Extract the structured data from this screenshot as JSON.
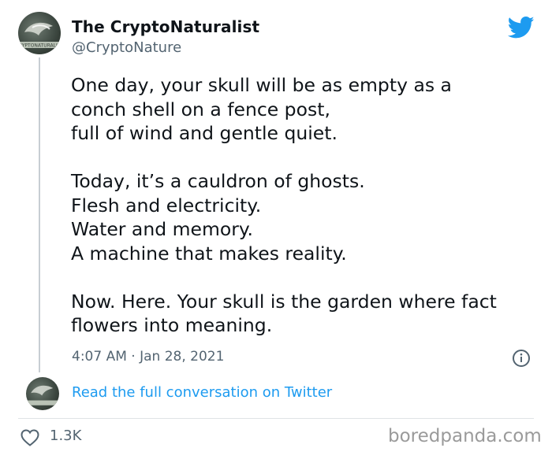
{
  "author": {
    "name": "The CryptoNaturalist",
    "handle": "@CryptoNature",
    "avatar_text": "CRYPTONATURALIST"
  },
  "tweet": {
    "paragraphs": [
      "One day, your skull will be as empty as a\nconch shell on a fence post,\nfull of wind and gentle quiet.",
      "Today, it’s a cauldron of ghosts.\nFlesh and electricity.\nWater and memory.\nA machine that makes reality.",
      "Now. Here. Your skull is the garden where fact\nflowers into meaning."
    ],
    "timestamp": "4:07 AM · Jan 28, 2021"
  },
  "footer": {
    "read_more": "Read the full conversation on Twitter",
    "like_count": "1.3K",
    "watermark": "boredpanda.com"
  },
  "colors": {
    "accent": "#1d9bf0",
    "secondary_text": "#536471",
    "primary_text": "#0f1419"
  },
  "icons": [
    "twitter-bird-icon",
    "info-icon",
    "heart-icon"
  ]
}
